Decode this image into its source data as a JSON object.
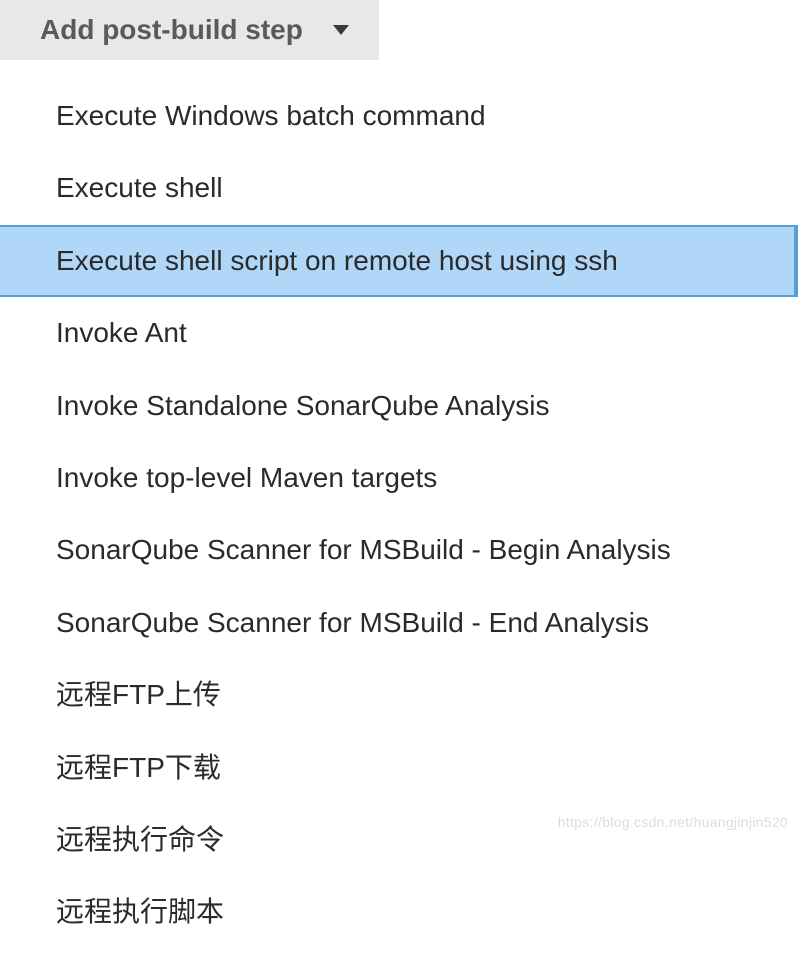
{
  "button": {
    "label": "Add post-build step"
  },
  "menu": {
    "items": [
      {
        "label": "Execute Windows batch command",
        "highlighted": false
      },
      {
        "label": "Execute shell",
        "highlighted": false
      },
      {
        "label": "Execute shell script on remote host using ssh",
        "highlighted": true
      },
      {
        "label": "Invoke Ant",
        "highlighted": false
      },
      {
        "label": "Invoke Standalone SonarQube Analysis",
        "highlighted": false
      },
      {
        "label": "Invoke top-level Maven targets",
        "highlighted": false
      },
      {
        "label": "SonarQube Scanner for MSBuild - Begin Analysis",
        "highlighted": false
      },
      {
        "label": "SonarQube Scanner for MSBuild - End Analysis",
        "highlighted": false
      },
      {
        "label": "远程FTP上传",
        "highlighted": false
      },
      {
        "label": "远程FTP下载",
        "highlighted": false
      },
      {
        "label": "远程执行命令",
        "highlighted": false
      },
      {
        "label": "远程执行脚本",
        "highlighted": false
      }
    ]
  },
  "watermark": "https://blog.csdn.net/huangjinjin520"
}
